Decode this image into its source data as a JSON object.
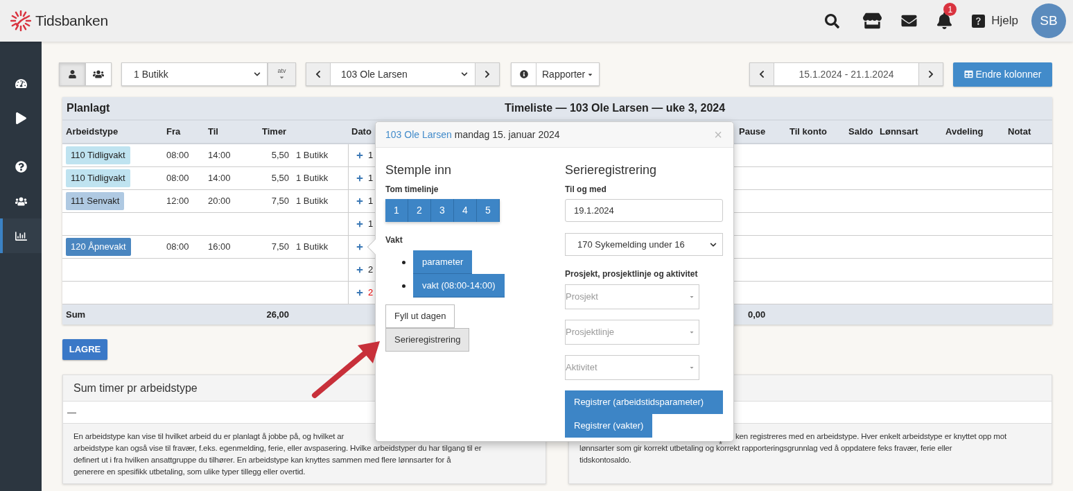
{
  "topbar": {
    "brand": "Tidsbanken",
    "notification_count": "1",
    "help": "Hjelp",
    "avatar": "SB"
  },
  "sidebar": {
    "items": [
      {
        "kind": "gauge",
        "selected": false
      },
      {
        "kind": "play",
        "selected": false
      },
      {
        "kind": "help",
        "selected": false
      },
      {
        "kind": "users",
        "selected": false
      },
      {
        "kind": "chart",
        "selected": true
      }
    ]
  },
  "toolbar": {
    "view_toggle": [
      {
        "kind": "person",
        "selected": true
      },
      {
        "kind": "group",
        "selected": false
      }
    ],
    "department": "1 Butikk",
    "atv": "atv",
    "employee": "103 Ole Larsen",
    "reports": "Rapporter",
    "date_range": "15.1.2024 - 21.1.2024",
    "change_columns": "Endre kolonner"
  },
  "table": {
    "label": "Planlagt",
    "title": "Timeliste — 103 Ole Larsen — uke 3, 2024",
    "columns": [
      "Arbeidstype",
      "Fra",
      "Til",
      "Timer",
      "Dato",
      "Pause",
      "Til konto",
      "Saldo",
      "Lønnsart",
      "Avdeling",
      "Notat"
    ],
    "rows": [
      {
        "worktype": {
          "label": "110 Tidligvakt",
          "color": "#bfe3f0"
        },
        "from": "08:00",
        "to": "14:00",
        "hours": "5,50",
        "department": "1 Butikk",
        "date": "1",
        "holiday": false
      },
      {
        "worktype": {
          "label": "110 Tidligvakt",
          "color": "#bfe3f0"
        },
        "from": "08:00",
        "to": "14:00",
        "hours": "5,50",
        "department": "1 Butikk",
        "date": "1",
        "holiday": false
      },
      {
        "worktype": {
          "label": "111 Senvakt",
          "color": "#afc9e2"
        },
        "from": "12:00",
        "to": "20:00",
        "hours": "7,50",
        "department": "1 Butikk",
        "date": "1",
        "holiday": false
      },
      {
        "date": "1",
        "holiday": false
      },
      {
        "worktype": {
          "label": "120 Åpnevakt",
          "color": "#4a86c0"
        },
        "from": "08:00",
        "to": "16:00",
        "hours": "7,50",
        "department": "1 Butikk"
      },
      {
        "date": "2",
        "holiday": false
      },
      {
        "date": "2",
        "holiday": true
      }
    ],
    "sum": {
      "label": "Sum",
      "hours": "26,00",
      "pause": "0,00"
    }
  },
  "save_button": "LAGRE",
  "panels": [
    {
      "title": "Sum timer pr arbeidstype",
      "value": "—",
      "lines": [
        "En arbeidstype kan vise til hvilket arbeid du er planlagt å jobbe på, og hvilket ar",
        "arbeidstype kan også vise til fravær, f.eks. egenmelding, ferie, eller avspasering. Hvilke arbeidstyper du har tilgang til er",
        "definert ut i fra hvilken ansattgruppe du tilhører. En arbeidstype kan knyttes sammen med flere lønnsarter for å",
        "generere en spesifikk utbetaling, som ulike typer tillegg eller overtid."
      ]
    },
    {
      "lines": [
        "ken registreres med en arbeidstype. Hver enkelt arbeidstype er knyttet opp mot",
        "lønnsarter som gir korrekt utbetaling og korrekt rapporteringsgrunnlag ved å oppdatere feks fravær, ferie eller",
        "tidskontosaldo."
      ]
    }
  ],
  "popover": {
    "employee_link": "103 Ole Larsen",
    "date": "mandag 15. januar 2024",
    "close": "×",
    "left": {
      "heading": "Stemple inn",
      "timeline_label": "Tom timelinje",
      "timeline_buttons": [
        "1",
        "2",
        "3",
        "4",
        "5"
      ],
      "shift_label": "Vakt",
      "shift_buttons": [
        "parameter",
        "vakt (08:00-14:00)"
      ],
      "actions": [
        {
          "label": "Fyll ut dagen",
          "selected": false
        },
        {
          "label": "Serieregistrering",
          "selected": true
        }
      ]
    },
    "right": {
      "heading": "Serieregistrering",
      "until_label": "Til og med",
      "until_value": "19.1.2024",
      "worktype_select": "170 Sykemelding under 16",
      "project_label": "Prosjekt, prosjektlinje og aktivitet",
      "project_selects": [
        "Prosjekt",
        "Prosjektlinje",
        "Aktivitet"
      ],
      "register_buttons": [
        "Registrer (arbeidstidsparameter)",
        "Registrer (vakter)"
      ],
      "footnote": "*"
    }
  }
}
